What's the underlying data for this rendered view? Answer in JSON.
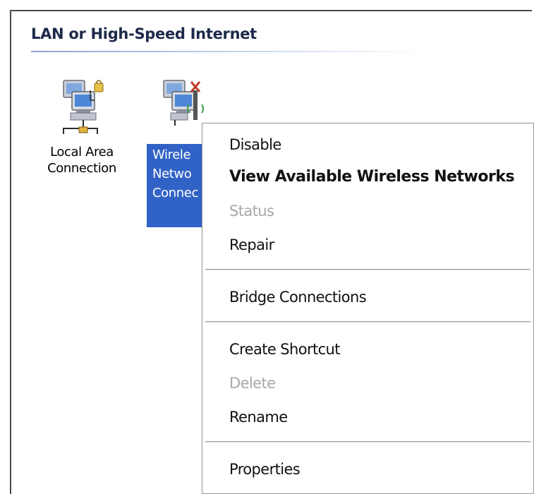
{
  "group": {
    "title": "LAN or High-Speed Internet"
  },
  "items": [
    {
      "label": "Local Area\nConnection",
      "icon": "lan-connection-icon",
      "selected": false
    },
    {
      "label": "Wirele\nNetwo\nConnec",
      "icon": "wireless-connection-icon",
      "selected": true
    }
  ],
  "context_menu": {
    "disable": "Disable",
    "view_networks": "View Available Wireless Networks",
    "status": "Status",
    "repair": "Repair",
    "bridge": "Bridge Connections",
    "create_shortcut": "Create Shortcut",
    "delete": "Delete",
    "rename": "Rename",
    "properties": "Properties"
  },
  "colors": {
    "selection": "#3162c5",
    "disabled_text": "#a8a8a8",
    "header_rule": "#8aa3d9"
  }
}
